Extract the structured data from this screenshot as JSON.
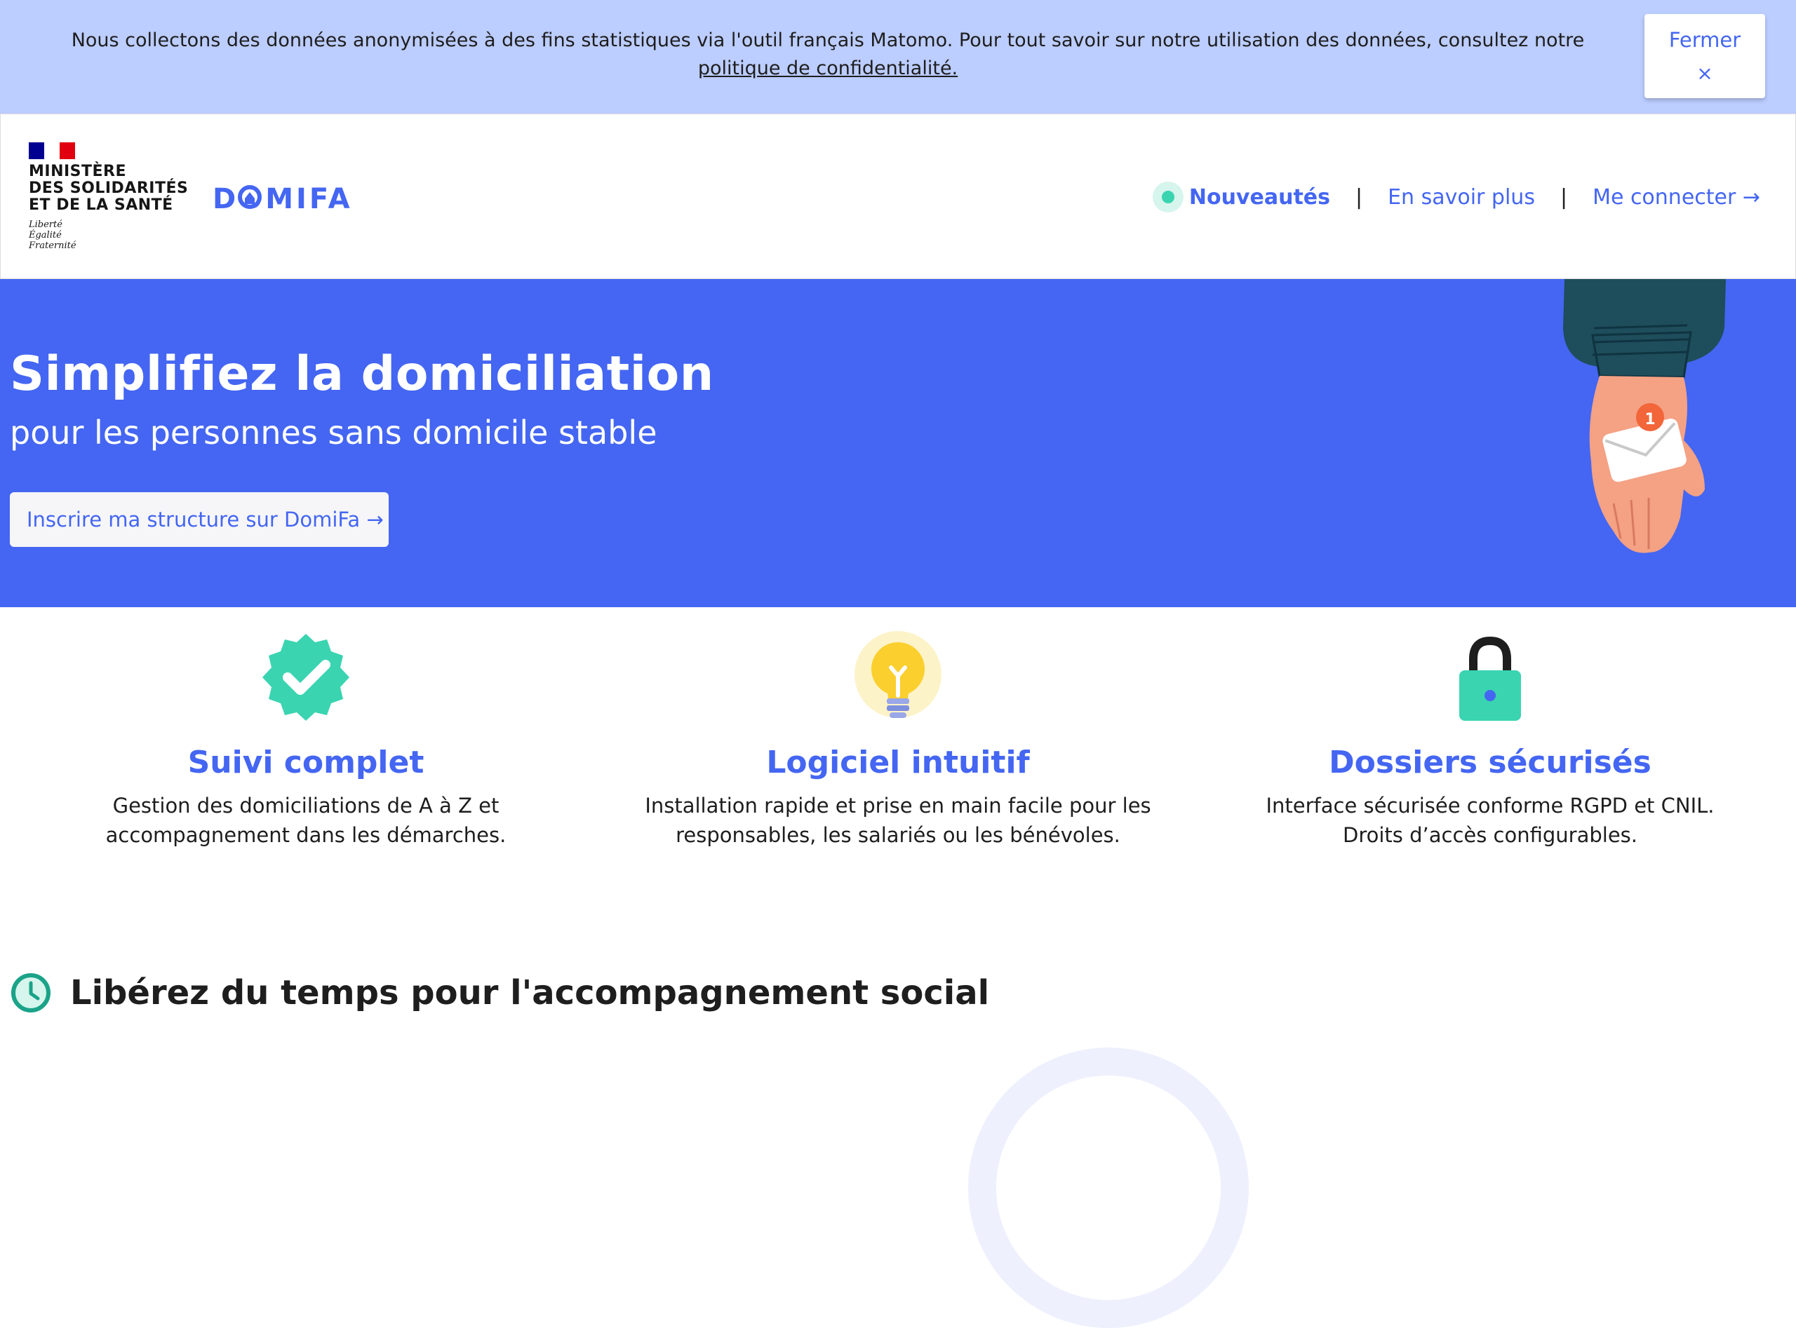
{
  "cookie_banner": {
    "text": "Nous collectons des données anonymisées à des fins statistiques via l'outil français Matomo. Pour tout savoir sur notre utilisation des données, consultez notre",
    "link_text": "politique de confidentialité.",
    "close_label": "Fermer",
    "close_icon": "×"
  },
  "header": {
    "ministry_lines": [
      "MINISTÈRE",
      "DES SOLIDARITÉS",
      "ET DE LA SANTÉ"
    ],
    "motto": [
      "Liberté",
      "Égalité",
      "Fraternité"
    ],
    "brand": "DOMIFA",
    "nav": {
      "news": "Nouveautés",
      "separator": "|",
      "learn_more": "En savoir plus",
      "login": "Me connecter →"
    }
  },
  "hero": {
    "title": "Simplifiez la domiciliation",
    "subtitle": "pour les personnes sans domicile stable",
    "cta": "Inscrire ma structure sur DomiFa →",
    "badge_count": "1"
  },
  "features": [
    {
      "title": "Suivi complet",
      "text_lines": [
        "Gestion des domiciliations de A à Z et",
        "accompagnement dans les démarches."
      ],
      "icon": "verified-badge-icon"
    },
    {
      "title": "Logiciel intuitif",
      "text_lines": [
        "Installation rapide et prise en main facile pour les",
        "responsables, les salariés ou les bénévoles."
      ],
      "icon": "lightbulb-icon"
    },
    {
      "title": "Dossiers sécurisés",
      "text_lines": [
        "Interface sécurisée conforme RGPD et CNIL.",
        "Droits d’accès configurables."
      ],
      "icon": "padlock-icon"
    }
  ],
  "section": {
    "title": "Libérez du temps pour l'accompagnement social",
    "icon": "clock-icon"
  },
  "colors": {
    "primary": "#4466f2",
    "cookie_bg": "#bccdff",
    "accent": "#3ad4b1",
    "text": "#1e1e1e"
  }
}
